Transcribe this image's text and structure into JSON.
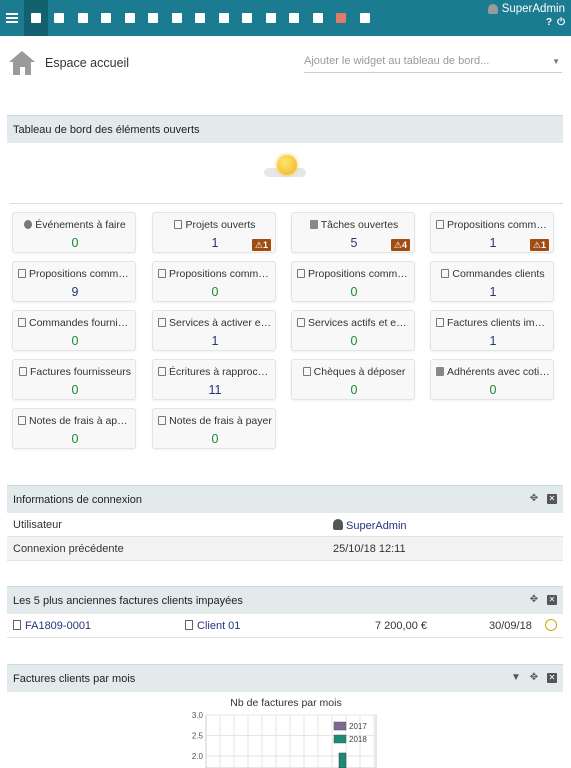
{
  "topbar": {
    "user_name": "SuperAdmin",
    "nav_icons": [
      "home-icon",
      "companies-icon",
      "users-icon",
      "products-icon",
      "projects-icon",
      "person-icon",
      "commercial-icon",
      "billing-icon",
      "bank-icon",
      "accounting-icon",
      "members-icon",
      "hrm-icon",
      "tools-icon",
      "report-icon",
      "documents-icon"
    ],
    "help_icon": "?",
    "logout_icon": "⏻"
  },
  "home": {
    "title": "Espace accueil",
    "widget_placeholder": "Ajouter le widget au tableau de bord..."
  },
  "dashboard": {
    "title": "Tableau de bord des éléments ouverts",
    "boxes": [
      {
        "label": "Événements à faire",
        "value": "0",
        "color": "green",
        "icon": "clock-icon",
        "warn": ""
      },
      {
        "label": "Projets ouverts",
        "value": "1",
        "color": "blue",
        "icon": "project-icon",
        "warn": "1"
      },
      {
        "label": "Tâches ouvertes",
        "value": "5",
        "color": "blue",
        "icon": "task-icon",
        "warn": "4"
      },
      {
        "label": "Propositions commerciales",
        "value": "1",
        "color": "blue",
        "icon": "proposal-icon",
        "warn": "1"
      },
      {
        "label": "Propositions commerciales",
        "value": "9",
        "color": "blue",
        "icon": "proposal-icon",
        "warn": ""
      },
      {
        "label": "Propositions commerciales",
        "value": "0",
        "color": "green",
        "icon": "proposal-icon",
        "warn": ""
      },
      {
        "label": "Propositions commerciales",
        "value": "0",
        "color": "green",
        "icon": "proposal-icon",
        "warn": ""
      },
      {
        "label": "Commandes clients",
        "value": "1",
        "color": "blue",
        "icon": "order-icon",
        "warn": ""
      },
      {
        "label": "Commandes fournisseurs",
        "value": "0",
        "color": "green",
        "icon": "order-icon",
        "warn": ""
      },
      {
        "label": "Services à activer en retard",
        "value": "1",
        "color": "blue",
        "icon": "service-icon",
        "warn": ""
      },
      {
        "label": "Services actifs et expirés",
        "value": "0",
        "color": "green",
        "icon": "service-icon",
        "warn": ""
      },
      {
        "label": "Factures clients impayées",
        "value": "1",
        "color": "blue",
        "icon": "invoice-icon",
        "warn": ""
      },
      {
        "label": "Factures fournisseurs",
        "value": "0",
        "color": "green",
        "icon": "invoice-icon",
        "warn": ""
      },
      {
        "label": "Écritures à rapprocher",
        "value": "11",
        "color": "blue",
        "icon": "bank-icon",
        "warn": ""
      },
      {
        "label": "Chèques à déposer",
        "value": "0",
        "color": "green",
        "icon": "cheque-icon",
        "warn": ""
      },
      {
        "label": "Adhérents avec cotisation",
        "value": "0",
        "color": "green",
        "icon": "member-icon",
        "warn": ""
      },
      {
        "label": "Notes de frais à approuver",
        "value": "0",
        "color": "green",
        "icon": "expense-icon",
        "warn": ""
      },
      {
        "label": "Notes de frais à payer",
        "value": "0",
        "color": "green",
        "icon": "expense-icon",
        "warn": ""
      }
    ]
  },
  "login_info": {
    "title": "Informations de connexion",
    "user_label": "Utilisateur",
    "user_value": "SuperAdmin",
    "prev_label": "Connexion précédente",
    "prev_value": "25/10/18 12:11"
  },
  "unpaid": {
    "title": "Les 5 plus anciennes factures clients impayées",
    "rows": [
      {
        "ref": "FA1809-0001",
        "client": "Client 01",
        "amount": "7 200,00 €",
        "date": "30/09/18"
      }
    ]
  },
  "invoices_chart": {
    "title": "Factures clients par mois"
  },
  "chart_data": {
    "type": "bar",
    "title": "Nb de factures par mois",
    "series": [
      {
        "name": "2017",
        "color": "#7f6a8f"
      },
      {
        "name": "2018",
        "color": "#1c8a78"
      }
    ],
    "yticks": [
      "3.0",
      "2.5",
      "2.0"
    ],
    "ylim": [
      0,
      3
    ]
  }
}
